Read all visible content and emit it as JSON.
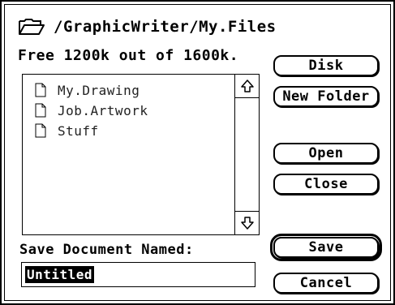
{
  "header": {
    "path": "/GraphicWriter/My.Files",
    "free_space": "Free 1200k out of 1600k."
  },
  "file_list": {
    "items": [
      {
        "name": "My.Drawing",
        "icon": "document-icon"
      },
      {
        "name": "Job.Artwork",
        "icon": "document-icon"
      },
      {
        "name": "Stuff",
        "icon": "document-icon"
      }
    ]
  },
  "buttons": {
    "disk": "Disk",
    "new_folder": "New Folder",
    "open": "Open",
    "close": "Close",
    "save": "Save",
    "cancel": "Cancel"
  },
  "save_form": {
    "label": "Save Document Named:",
    "value": "Untitled"
  },
  "icons": {
    "header": "open-folder-icon",
    "scroll_up": "arrow-up-icon",
    "scroll_down": "arrow-down-icon"
  }
}
